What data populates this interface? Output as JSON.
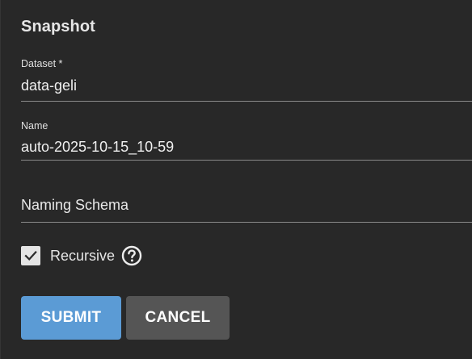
{
  "dialog": {
    "title": "Snapshot"
  },
  "fields": {
    "dataset": {
      "label": "Dataset *",
      "value": "data-geli"
    },
    "name": {
      "label": "Name",
      "value": "auto-2025-10-15_10-59"
    },
    "naming_schema": {
      "placeholder": "Naming Schema",
      "value": ""
    }
  },
  "recursive": {
    "label": "Recursive",
    "checked": true,
    "icons": {
      "check": "check-icon",
      "help": "help-circle-icon"
    }
  },
  "actions": {
    "submit_label": "SUBMIT",
    "cancel_label": "CANCEL"
  },
  "colors": {
    "background": "#282828",
    "text": "#e6e6e6",
    "underline": "#8a8a8a",
    "submit": "#5b9bd5",
    "cancel": "#555555",
    "checkbox": "#e4e4e4"
  }
}
